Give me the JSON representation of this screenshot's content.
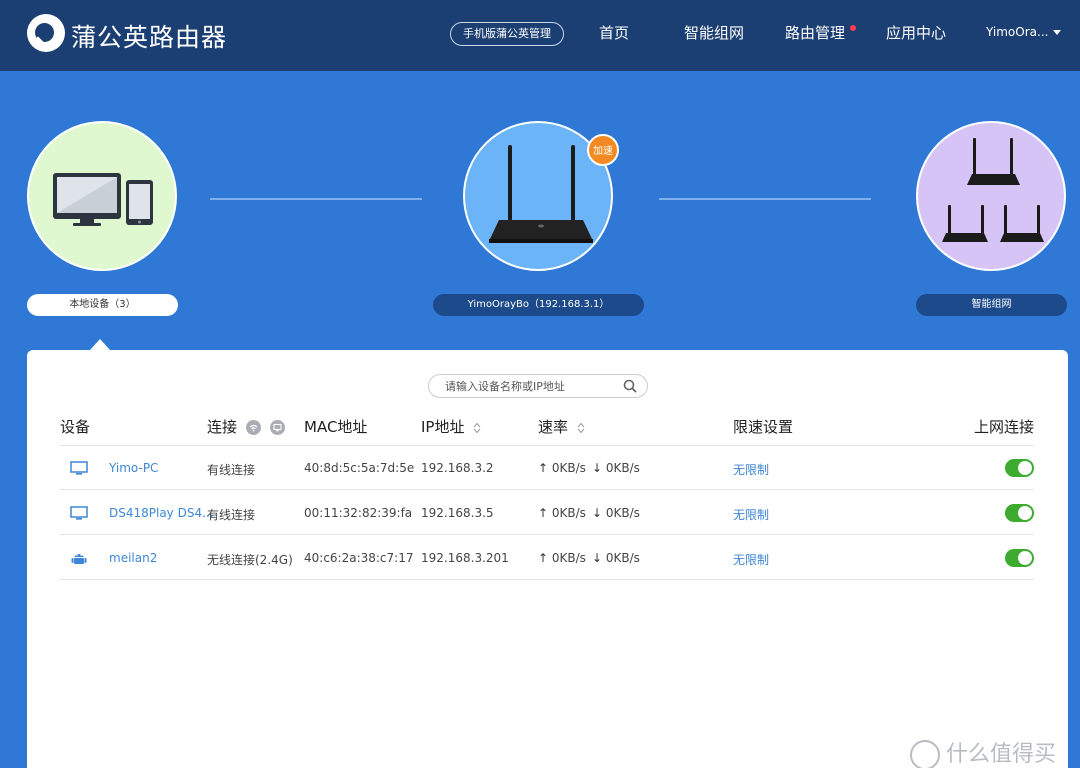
{
  "header": {
    "app_title": "蒲公英路由器",
    "mobile_button": "手机版蒲公英管理",
    "nav": [
      "首页",
      "智能组网",
      "路由管理",
      "应用中心"
    ],
    "user": "YimoOra..."
  },
  "topology": {
    "local_devices": "本地设备（3）",
    "router": "YimoOrayBo（192.168.3.1）",
    "boost_badge": "加速",
    "smart_network": "智能组网"
  },
  "panel": {
    "search_placeholder": "请输入设备名称或IP地址",
    "columns": {
      "device": "设备",
      "connection": "连接",
      "mac": "MAC地址",
      "ip": "IP地址",
      "speed": "速率",
      "limit": "限速设置",
      "online": "上网连接"
    },
    "rows": [
      {
        "icon": "monitor-icon",
        "name": "Yimo-PC",
        "connection": "有线连接",
        "mac": "40:8d:5c:5a:7d:5e",
        "ip": "192.168.3.2",
        "up": "0KB/s",
        "down": "0KB/s",
        "limit": "无限制",
        "online": true
      },
      {
        "icon": "monitor-icon",
        "name": "DS418Play DS4...",
        "connection": "有线连接",
        "mac": "00:11:32:82:39:fa",
        "ip": "192.168.3.5",
        "up": "0KB/s",
        "down": "0KB/s",
        "limit": "无限制",
        "online": true
      },
      {
        "icon": "android-icon",
        "name": "meilan2",
        "connection": "无线连接(2.4G)",
        "mac": "40:c6:2a:38:c7:17",
        "ip": "192.168.3.201",
        "up": "0KB/s",
        "down": "0KB/s",
        "limit": "无限制",
        "online": true
      }
    ]
  },
  "watermark": "什么值得买",
  "colors": {
    "header": "#1c3f73",
    "background": "#2f78d6",
    "toggle_on": "#3cab2f",
    "link": "#3e86d6",
    "badge": "#f38a21"
  }
}
